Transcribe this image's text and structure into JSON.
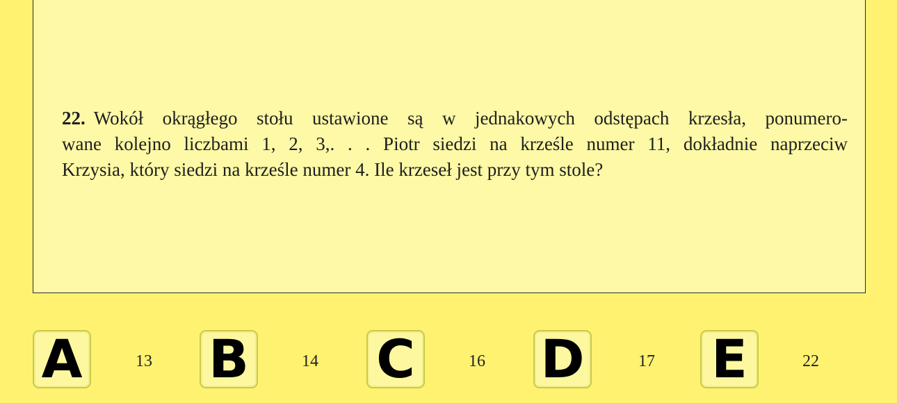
{
  "question": {
    "number": "22.",
    "lines": [
      "Wokół okrągłego stołu ustawione są w jednakowych odstępach krzesła, ponumero-",
      "wane kolejno liczbami 1, 2, 3,. . .  Piotr siedzi na krześle numer 11, dokładnie naprzeciw",
      "Krzysia, który siedzi na krześle numer 4. Ile krzeseł jest przy tym stole?"
    ]
  },
  "answers": [
    {
      "letter": "A",
      "value": "13"
    },
    {
      "letter": "B",
      "value": "14"
    },
    {
      "letter": "C",
      "value": "16"
    },
    {
      "letter": "D",
      "value": "17"
    },
    {
      "letter": "E",
      "value": "22"
    }
  ],
  "colors": {
    "background": "#fff271",
    "panel": "#fdf9a6",
    "letter_box_border": "#c8ca4a"
  }
}
